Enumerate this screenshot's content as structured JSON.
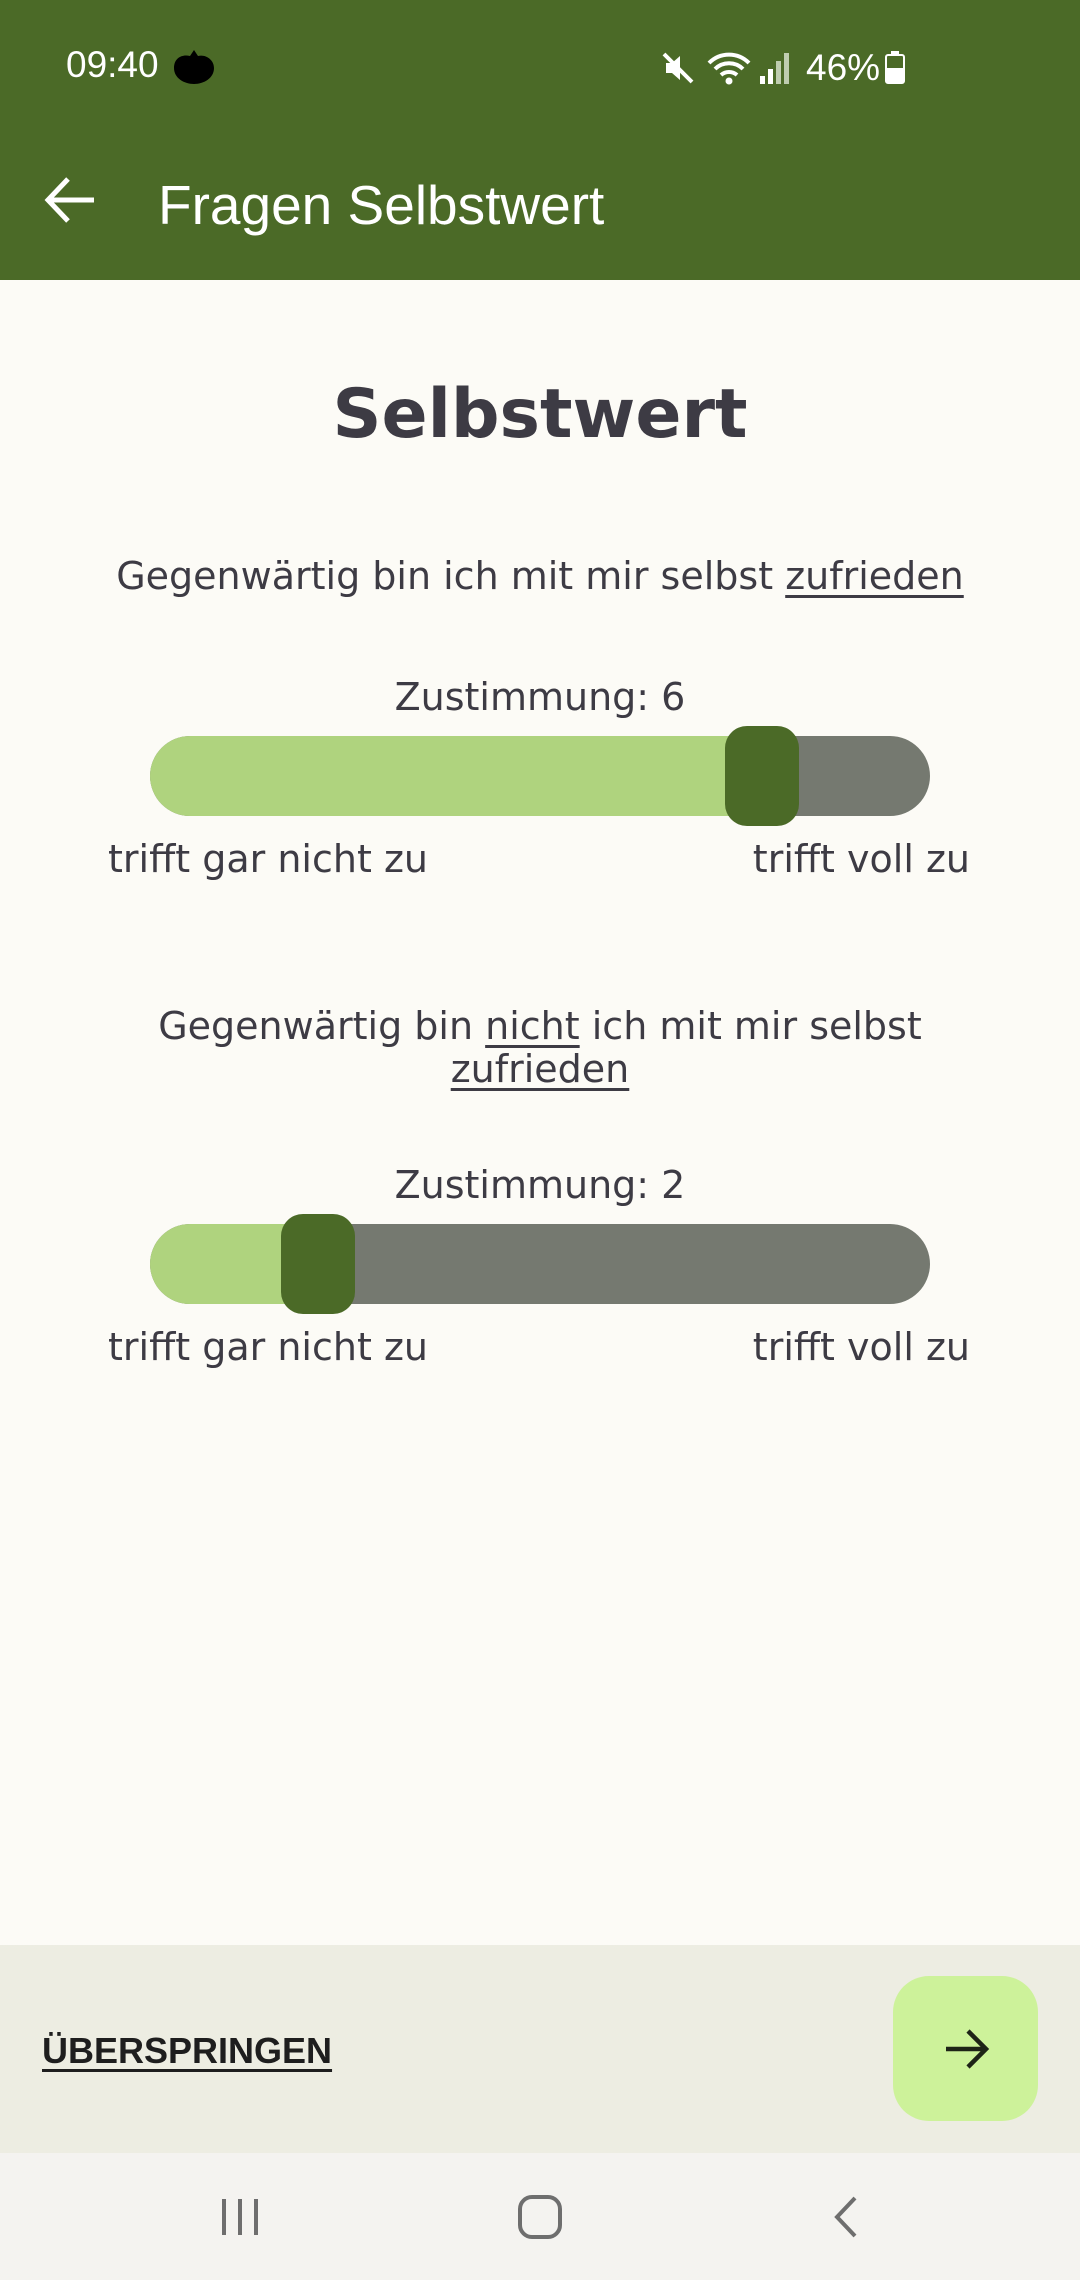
{
  "status_bar": {
    "time": "09:40",
    "battery_percent": "46%",
    "icons": [
      "cat-icon",
      "mute-icon",
      "wifi-icon",
      "signal-icon",
      "battery-icon"
    ]
  },
  "app_bar": {
    "title": "Fragen Selbstwert",
    "back_icon": "arrow-left-icon"
  },
  "main": {
    "title": "Selbstwert",
    "questions": [
      {
        "text_before": "Gegenwärtig bin ich mit mir selbst ",
        "text_underlined": "zufrieden",
        "value_label": "Zustimmung: 6",
        "value": 6,
        "min": 1,
        "max": 7,
        "min_label": "trifft gar nicht zu",
        "max_label": "trifft voll zu"
      },
      {
        "text_before": "Gegenwärtig bin ",
        "text_underlined_1": "nicht",
        "text_middle": " ich mit mir selbst",
        "text_underlined_2": "zufrieden",
        "value_label": "Zustimmung: 2",
        "value": 2,
        "min": 1,
        "max": 7,
        "min_label": "trifft gar nicht zu",
        "max_label": "trifft voll zu"
      }
    ]
  },
  "footer": {
    "skip_label": "ÜBERSPRINGEN",
    "next_icon": "arrow-right-icon"
  },
  "nav_bar": {
    "icons": [
      "recent-apps-icon",
      "home-icon",
      "back-icon"
    ]
  },
  "colors": {
    "primary": "#4B6A27",
    "slider_fill": "#AFD37E",
    "slider_track": "#757970",
    "next_button": "#CDF29A",
    "background": "#FCFBF6"
  }
}
